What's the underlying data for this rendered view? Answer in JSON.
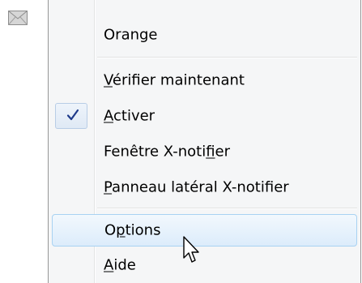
{
  "tray_icon": "envelope-icon",
  "menu": {
    "items": [
      {
        "prefix": "",
        "accel": "",
        "suffix": "Orange"
      },
      {
        "prefix": "",
        "accel": "V",
        "suffix": "érifier maintenant"
      },
      {
        "prefix": "",
        "accel": "A",
        "suffix": "ctiver",
        "checked": true
      },
      {
        "prefix": "Fenêtre X-noti",
        "accel": "f",
        "suffix": "ier"
      },
      {
        "prefix": "",
        "accel": "P",
        "suffix": "anneau latéral X-notifier"
      },
      {
        "prefix": "O",
        "accel": "p",
        "suffix": "tions",
        "highlighted": true
      },
      {
        "prefix": "",
        "accel": "A",
        "suffix": "ide"
      }
    ]
  },
  "colors": {
    "menu_bg": "#f5f6f7",
    "highlight_border": "#a8d2f2",
    "check_color": "#1e3a8a"
  },
  "cursor": "arrow-cursor-icon"
}
